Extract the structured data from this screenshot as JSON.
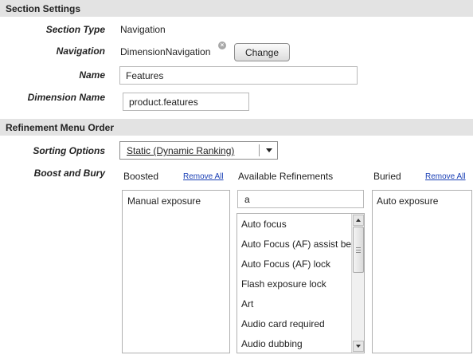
{
  "section_settings": {
    "header": "Section Settings",
    "section_type_label": "Section Type",
    "section_type_value": "Navigation",
    "navigation_label": "Navigation",
    "navigation_value": "DimensionNavigation",
    "change_button": "Change",
    "name_label": "Name",
    "name_value": "Features",
    "dimension_name_label": "Dimension Name",
    "dimension_name_value": "product.features"
  },
  "refinement_menu": {
    "header": "Refinement Menu Order",
    "sorting_label": "Sorting Options",
    "sorting_value": "Static (Dynamic Ranking)",
    "boost_bury_label": "Boost and Bury",
    "boosted": {
      "title": "Boosted",
      "remove_all": "Remove All",
      "items": [
        "Manual exposure"
      ]
    },
    "available": {
      "title": "Available Refinements",
      "filter_value": "a",
      "items": [
        "Auto focus",
        "Auto Focus (AF) assist beam",
        "Auto Focus (AF) lock",
        "Flash exposure lock",
        "Art",
        "Audio card required",
        "Audio dubbing"
      ]
    },
    "buried": {
      "title": "Buried",
      "remove_all": "Remove All",
      "items": [
        "Auto exposure"
      ]
    }
  },
  "icons": {
    "clear": "clear-icon",
    "dropdown": "chevron-down-icon",
    "scroll_up": "scroll-up-icon",
    "scroll_down": "scroll-down-icon"
  },
  "colors": {
    "section_header_bg": "#e3e3e3",
    "link": "#1a3fb5"
  }
}
